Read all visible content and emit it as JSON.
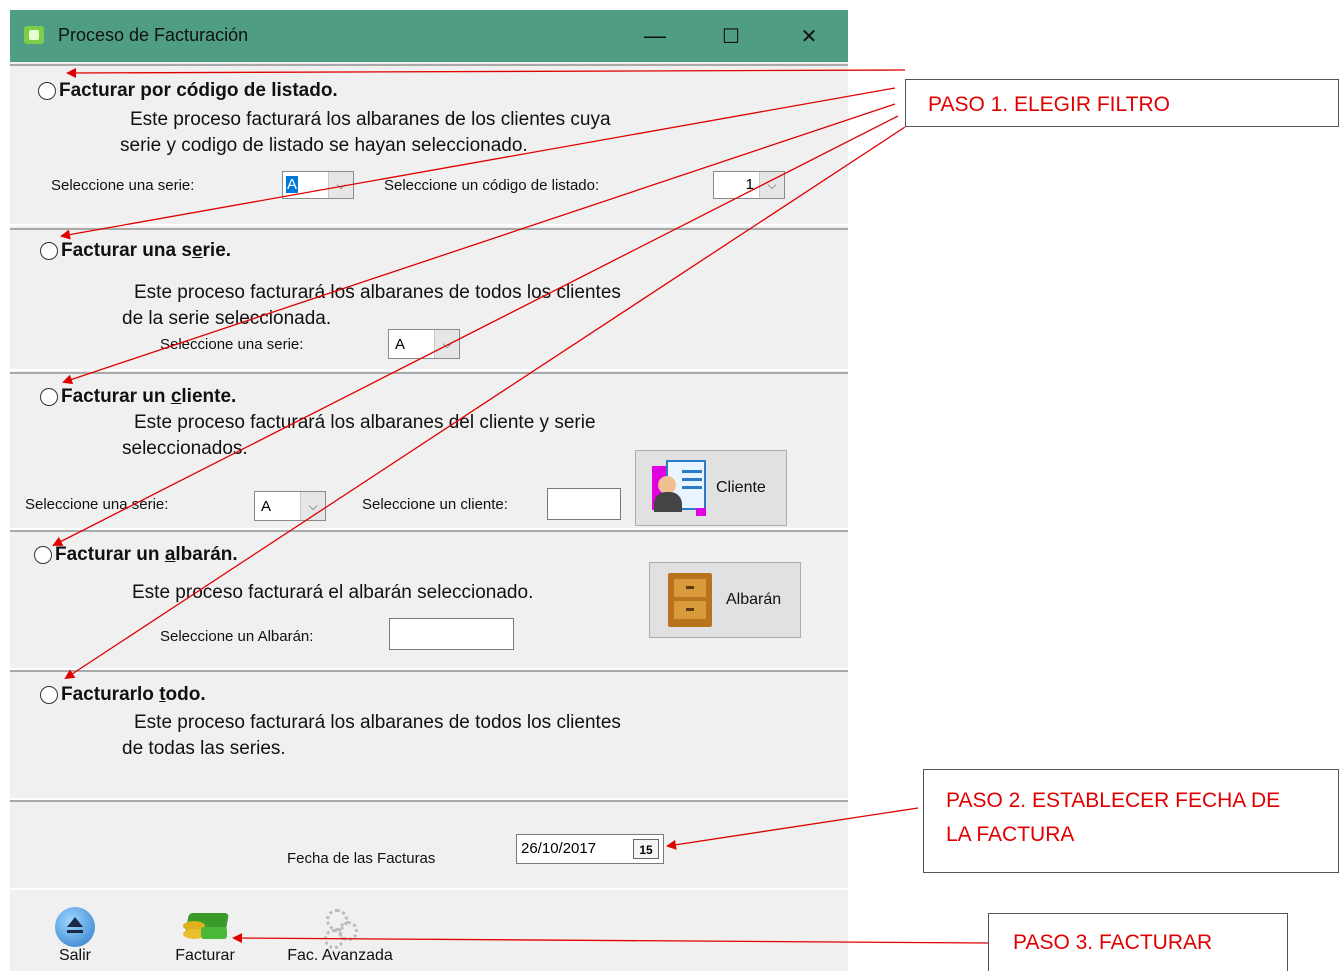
{
  "window": {
    "title": "Proceso de Facturación",
    "minimize": "—",
    "maximize": "☐",
    "close": "✕"
  },
  "sections": {
    "listado": {
      "label": "Facturar por código de listado.",
      "desc1": "Este proceso facturará los albaranes de los clientes cuya",
      "desc2": "serie y codigo de listado se hayan seleccionado.",
      "serie_label": "Seleccione una serie:",
      "serie_value": "A",
      "codigo_label": "Seleccione un código de listado:",
      "codigo_value": "1"
    },
    "serie": {
      "label_pre": "Facturar una s",
      "label_u": "e",
      "label_post": "rie.",
      "desc1": "Este proceso facturará los albaranes de todos los clientes",
      "desc2": "de la serie seleccionada.",
      "serie_label": "Seleccione una serie:",
      "serie_value": "A"
    },
    "cliente": {
      "label_pre": "Facturar un ",
      "label_u": "c",
      "label_post": "liente.",
      "desc1": "Este proceso facturará los albaranes del cliente y serie",
      "desc2": "seleccionados.",
      "serie_label": "Seleccione una serie:",
      "serie_value": "A",
      "cliente_label": "Seleccione un cliente:",
      "cliente_value": "",
      "button": "Cliente"
    },
    "albaran": {
      "label_pre": "Facturar un ",
      "label_u": "a",
      "label_post": "lbarán.",
      "desc1": "Este proceso facturará el albarán seleccionado.",
      "albaran_label": "Seleccione un Albarán:",
      "albaran_value": "",
      "button": "Albarán"
    },
    "todo": {
      "label_pre": "Facturarlo ",
      "label_u": "t",
      "label_post": "odo.",
      "desc1": "Este proceso facturará los albaranes de todos los clientes",
      "desc2": "de todas las series."
    }
  },
  "fecha": {
    "label": "Fecha de las Facturas",
    "value": "26/10/2017",
    "calendar": "15"
  },
  "toolbar": {
    "salir": "Salir",
    "facturar": "Facturar",
    "avanzada": "Fac. Avanzada"
  },
  "callouts": {
    "paso1": "PASO 1. ELEGIR FILTRO",
    "paso2_line1": "PASO 2. ESTABLECER FECHA DE",
    "paso2_line2": "LA FACTURA",
    "paso3": "PASO 3. FACTURAR"
  },
  "colors": {
    "titlebar": "#4f9d82",
    "annotation": "#e00000",
    "selection": "#0078d7"
  }
}
